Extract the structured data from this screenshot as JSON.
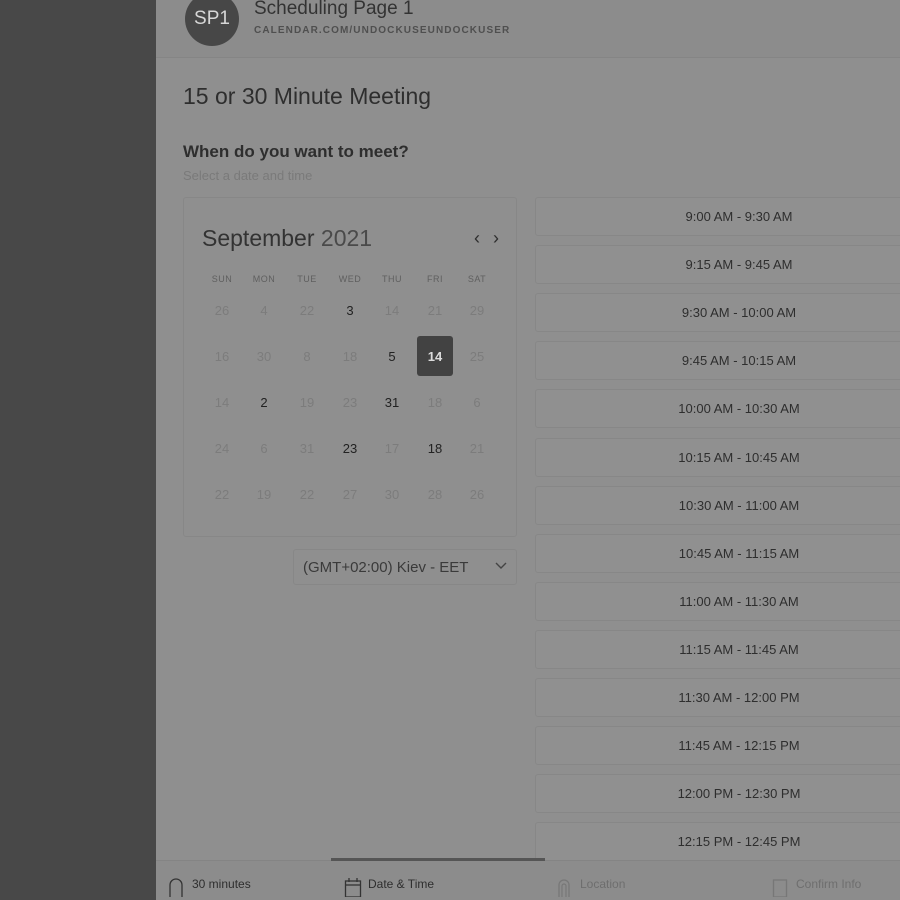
{
  "header": {
    "avatar_initials": "SP1",
    "page_name": "Scheduling Page 1",
    "page_url": "CALENDAR.COM/UNDOCKUSEUNDOCKUSER"
  },
  "meeting": {
    "title": "15 or 30 Minute Meeting",
    "question": "When do you want to meet?",
    "subtitle": "Select a date and time"
  },
  "calendar": {
    "month": "September",
    "year": "2021",
    "weekdays": [
      "SUN",
      "MON",
      "TUE",
      "WED",
      "THU",
      "FRI",
      "SAT"
    ],
    "weeks": [
      [
        {
          "d": "26",
          "state": "off"
        },
        {
          "d": "4",
          "state": "off"
        },
        {
          "d": "22",
          "state": "off"
        },
        {
          "d": "3",
          "state": "avail"
        },
        {
          "d": "14",
          "state": "off"
        },
        {
          "d": "21",
          "state": "off"
        },
        {
          "d": "29",
          "state": "off"
        }
      ],
      [
        {
          "d": "16",
          "state": "off"
        },
        {
          "d": "30",
          "state": "off"
        },
        {
          "d": "8",
          "state": "off"
        },
        {
          "d": "18",
          "state": "off"
        },
        {
          "d": "5",
          "state": "avail"
        },
        {
          "d": "14",
          "state": "selected"
        },
        {
          "d": "25",
          "state": "off"
        }
      ],
      [
        {
          "d": "14",
          "state": "off"
        },
        {
          "d": "2",
          "state": "avail"
        },
        {
          "d": "19",
          "state": "off"
        },
        {
          "d": "23",
          "state": "off"
        },
        {
          "d": "31",
          "state": "avail"
        },
        {
          "d": "18",
          "state": "off"
        },
        {
          "d": "6",
          "state": "off"
        }
      ],
      [
        {
          "d": "24",
          "state": "off"
        },
        {
          "d": "6",
          "state": "off"
        },
        {
          "d": "31",
          "state": "off"
        },
        {
          "d": "23",
          "state": "avail"
        },
        {
          "d": "17",
          "state": "off"
        },
        {
          "d": "18",
          "state": "avail"
        },
        {
          "d": "21",
          "state": "off"
        }
      ],
      [
        {
          "d": "22",
          "state": "off"
        },
        {
          "d": "19",
          "state": "off"
        },
        {
          "d": "22",
          "state": "off"
        },
        {
          "d": "27",
          "state": "off"
        },
        {
          "d": "30",
          "state": "off"
        },
        {
          "d": "28",
          "state": "off"
        },
        {
          "d": "26",
          "state": "off"
        }
      ]
    ]
  },
  "timezone": {
    "value": "(GMT+02:00) Kiev - EET"
  },
  "time_slots": [
    "9:00 AM - 9:30 AM",
    "9:15 AM - 9:45 AM",
    "9:30 AM - 10:00 AM",
    "9:45 AM - 10:15 AM",
    "10:00 AM - 10:30 AM",
    "10:15 AM - 10:45 AM",
    "10:30 AM - 11:00 AM",
    "10:45 AM - 11:15 AM",
    "11:00 AM - 11:30 AM",
    "11:15 AM - 11:45 AM",
    "11:30 AM - 12:00 PM",
    "11:45 AM - 12:15 PM",
    "12:00 PM - 12:30 PM",
    "12:15 PM - 12:45 PM"
  ],
  "footer": {
    "steps": [
      {
        "label": "30 minutes",
        "icon": "clock-icon",
        "active": false
      },
      {
        "label": "Date & Time",
        "icon": "calendar-icon",
        "active": true
      },
      {
        "label": "Location",
        "icon": "location-icon",
        "active": false
      },
      {
        "label": "Confirm Info",
        "icon": "confirm-icon",
        "active": false
      }
    ]
  }
}
